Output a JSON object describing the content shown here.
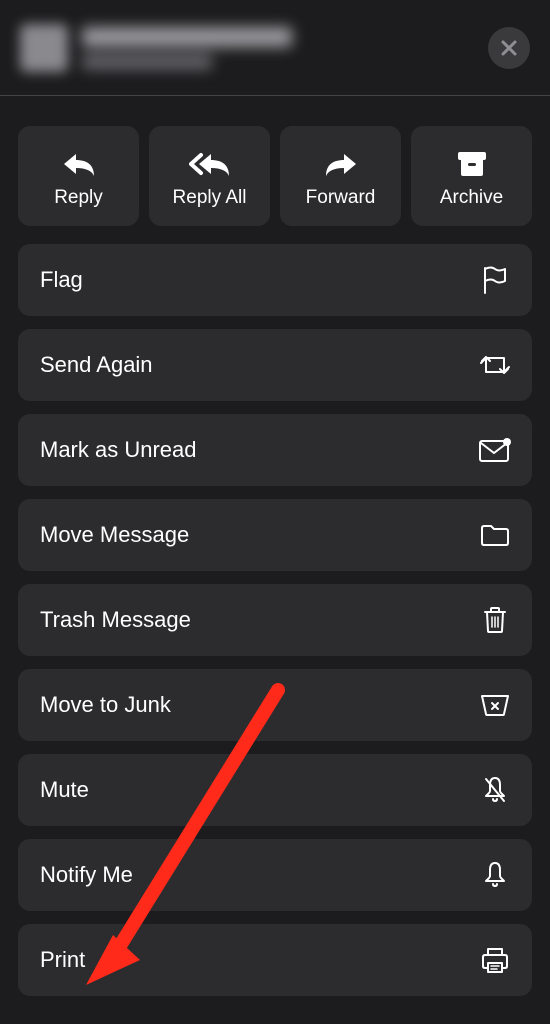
{
  "header": {
    "close_label": "Close"
  },
  "actions": {
    "reply": "Reply",
    "reply_all": "Reply All",
    "forward": "Forward",
    "archive": "Archive"
  },
  "menu": {
    "flag": "Flag",
    "send_again": "Send Again",
    "mark_unread": "Mark as Unread",
    "move_message": "Move Message",
    "trash_message": "Trash Message",
    "move_junk": "Move to Junk",
    "mute": "Mute",
    "notify_me": "Notify Me",
    "print": "Print"
  },
  "colors": {
    "bg": "#1c1c1e",
    "item_bg": "#2c2c2e",
    "arrow": "#ff2a1a"
  }
}
